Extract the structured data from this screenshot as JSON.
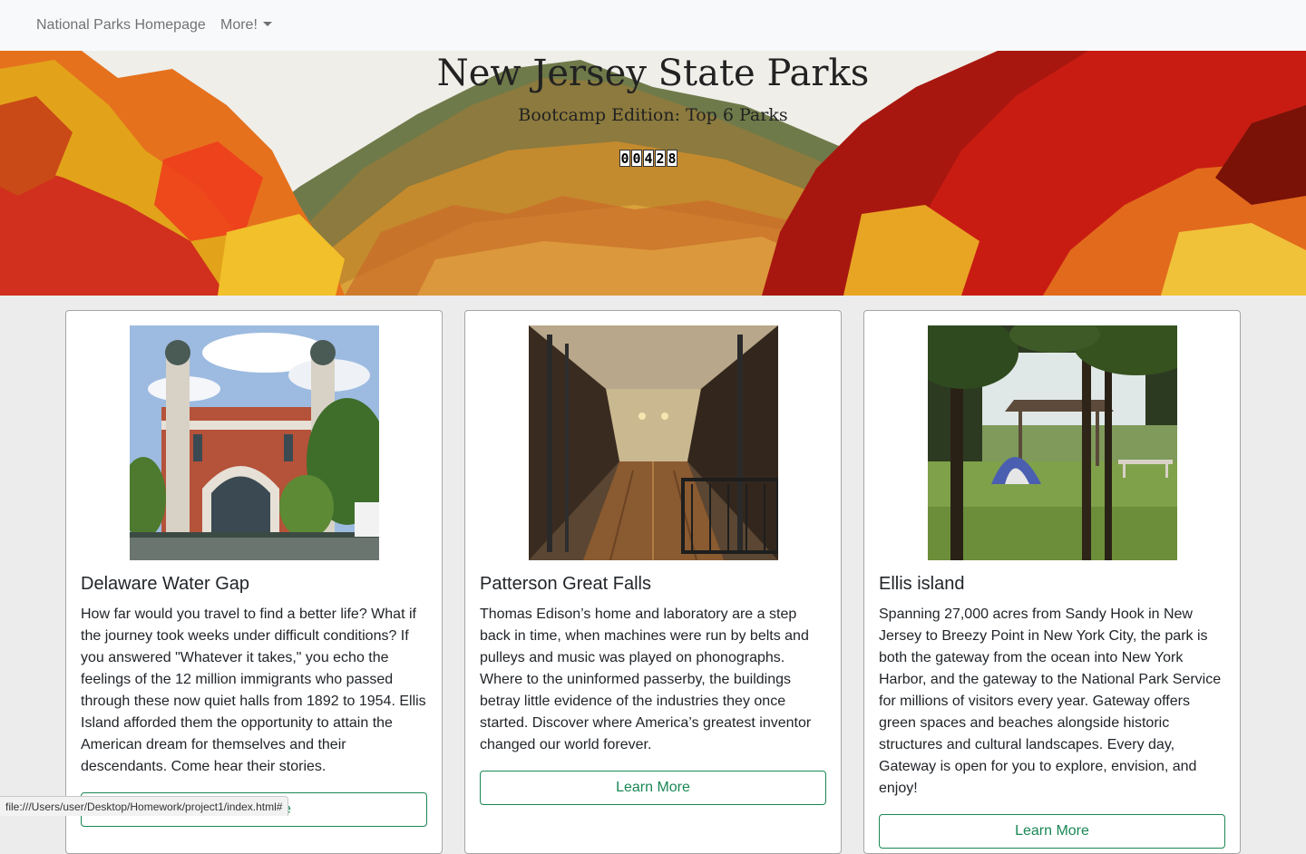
{
  "navbar": {
    "home_label": "National Parks Homepage",
    "more_label": "More!"
  },
  "hero": {
    "title": "New Jersey State Parks",
    "subtitle": "Bootcamp Edition: Top 6 Parks",
    "counter_digits": [
      "0",
      "0",
      "4",
      "2",
      "8"
    ]
  },
  "cards": [
    {
      "title": "Delaware Water Gap",
      "text": "How far would you travel to find a better life? What if the journey took weeks under difficult conditions? If you answered \"Whatever it takes,\" you echo the feelings of the 12 million immigrants who passed through these now quiet halls from 1892 to 1954. Ellis Island afforded them the opportunity to attain the American dream for themselves and their descendants. Come hear their stories.",
      "button_label": "Learn More"
    },
    {
      "title": "Patterson Great Falls",
      "text": "Thomas Edison’s home and laboratory are a step back in time, when machines were run by belts and pulleys and music was played on phonographs. Where to the uninformed passerby, the buildings betray little evidence of the industries they once started. Discover where America’s greatest inventor changed our world forever.",
      "button_label": "Learn More"
    },
    {
      "title": "Ellis island",
      "text": "Spanning 27,000 acres from Sandy Hook in New Jersey to Breezy Point in New York City, the park is both the gateway from the ocean into New York Harbor, and the gateway to the National Park Service for millions of visitors every year. Gateway offers green spaces and beaches alongside historic structures and cultural landscapes. Every day, Gateway is open for you to explore, envision, and enjoy!",
      "button_label": "Learn More"
    }
  ],
  "statusbar": {
    "url": "file:///Users/user/Desktop/Homework/project1/index.html#"
  },
  "colors": {
    "navbar_bg": "#f8f9fa",
    "page_bg": "#ececec",
    "button_accent": "#198754"
  },
  "icons": {
    "dropdown": "caret-down-icon"
  }
}
